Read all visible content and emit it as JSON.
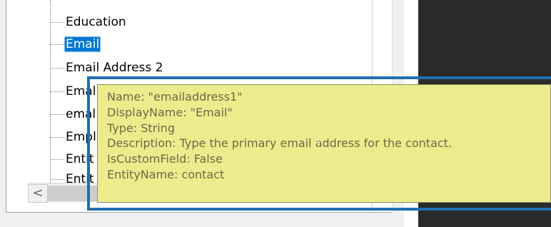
{
  "tree": {
    "items": [
      {
        "label": "Education",
        "selected": false
      },
      {
        "label": "Email",
        "selected": true
      },
      {
        "label": "Email Address 2",
        "selected": false
      },
      {
        "label": "Emal",
        "selected": false
      },
      {
        "label": "emal",
        "selected": false
      },
      {
        "label": "Empl",
        "selected": false
      },
      {
        "label": "Entit",
        "selected": false
      },
      {
        "label": "Entit",
        "selected": false
      }
    ]
  },
  "scrollbar": {
    "left_arrow": "<"
  },
  "tooltip": {
    "lines": [
      "Name: \"emailaddress1\"",
      "DisplayName: \"Email\"",
      "Type: String",
      "Description: Type the primary email address for the contact.",
      "IsCustomField: False",
      "EntityName: contact"
    ]
  },
  "colors": {
    "selection": "#0078d7",
    "tooltip_bg": "#ecec8c",
    "highlight_frame": "#1f6fb0",
    "dark_panel": "#2b2b2b"
  }
}
